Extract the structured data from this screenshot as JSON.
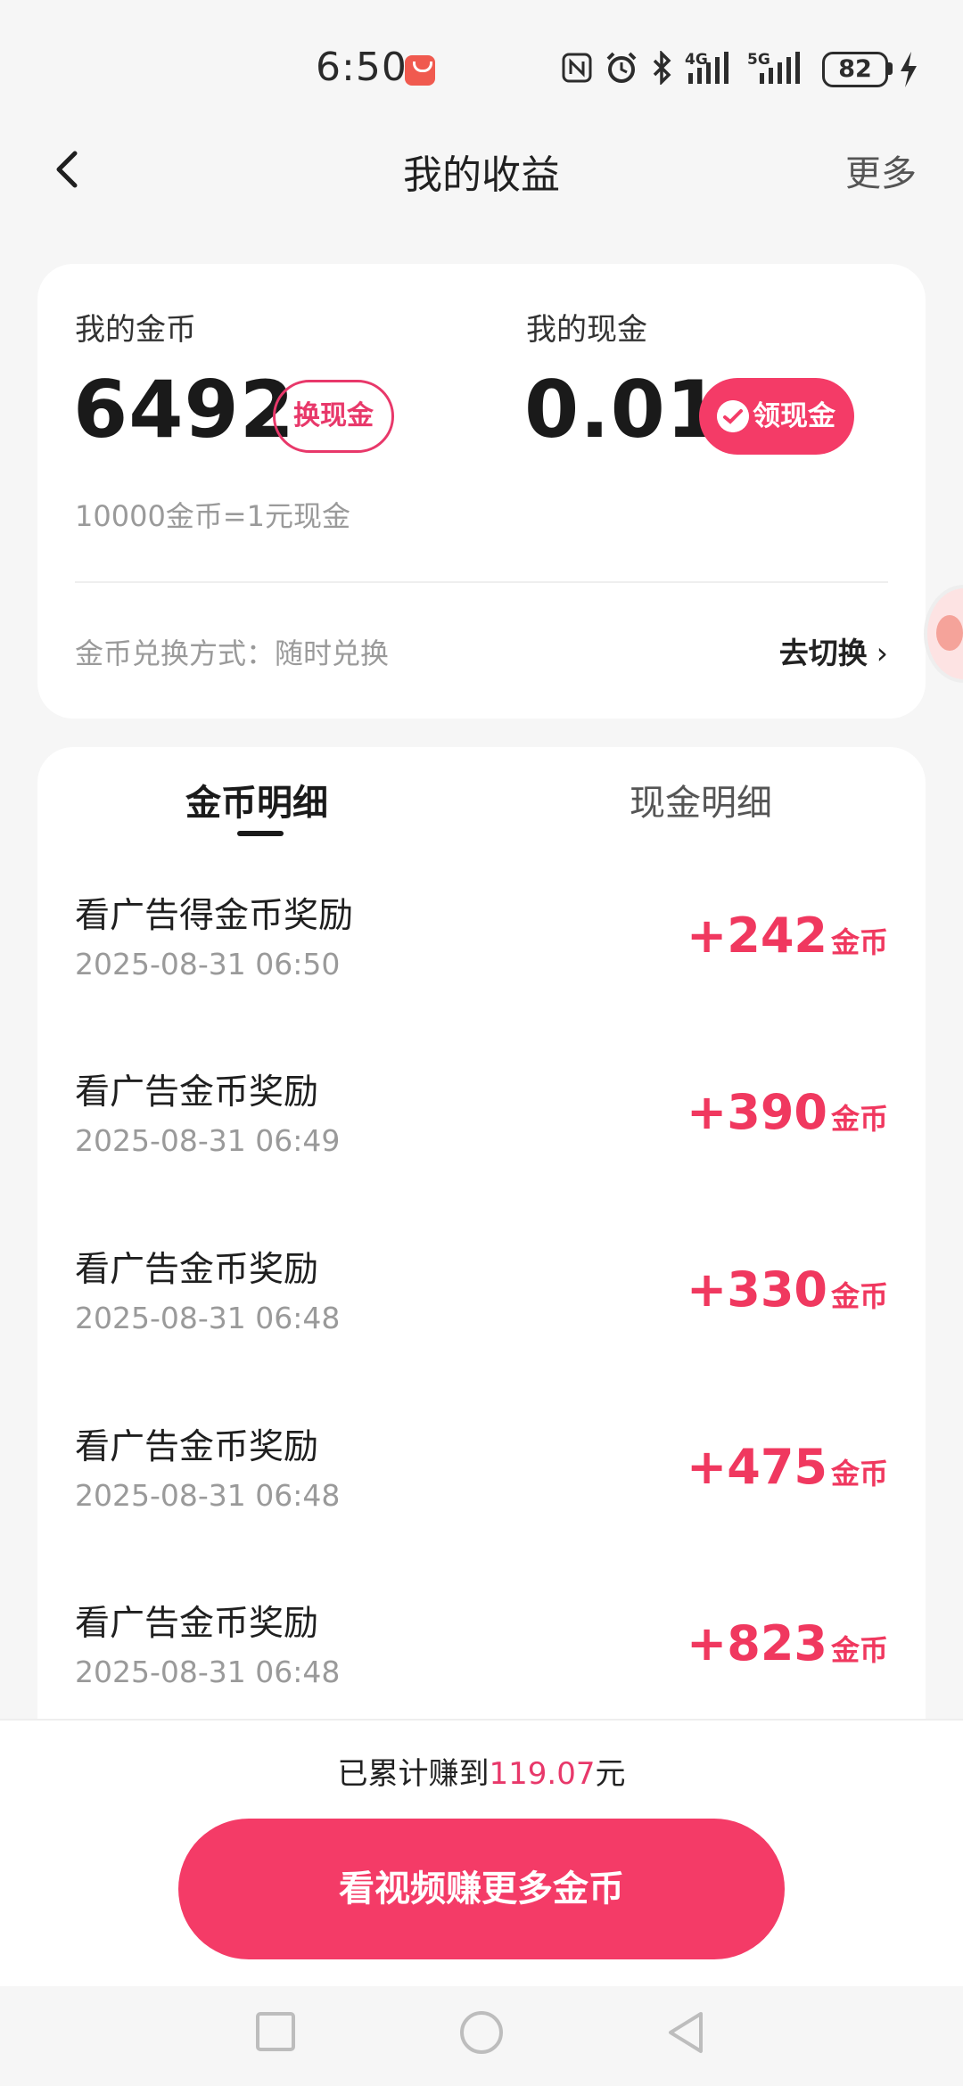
{
  "status_bar": {
    "time": "6:50",
    "network_4g": "4G",
    "network_5g": "5G",
    "battery": "82"
  },
  "header": {
    "title": "我的收益",
    "more_label": "更多"
  },
  "earnings": {
    "coins_label": "我的金币",
    "coins_value": "6492",
    "exchange_label": "换现金",
    "cash_label": "我的现金",
    "cash_value": "0.01",
    "claim_label": "领现金",
    "rate_text": "10000金币=1元现金",
    "mode_text": "金币兑换方式：随时兑换",
    "switch_label": "去切换"
  },
  "tabs": [
    {
      "label": "金币明细",
      "active": true
    },
    {
      "label": "现金明细",
      "active": false
    }
  ],
  "records": [
    {
      "title": "看广告得金币奖励",
      "date": "2025-08-31 06:50",
      "amount": "+242",
      "unit": "金币"
    },
    {
      "title": "看广告金币奖励",
      "date": "2025-08-31 06:49",
      "amount": "+390",
      "unit": "金币"
    },
    {
      "title": "看广告金币奖励",
      "date": "2025-08-31 06:48",
      "amount": "+330",
      "unit": "金币"
    },
    {
      "title": "看广告金币奖励",
      "date": "2025-08-31 06:48",
      "amount": "+475",
      "unit": "金币"
    },
    {
      "title": "看广告金币奖励",
      "date": "2025-08-31 06:48",
      "amount": "+823",
      "unit": "金币"
    }
  ],
  "footer": {
    "total_prefix": "已累计赚到",
    "total_value": "119.07",
    "total_suffix": "元",
    "cta_label": "看视频赚更多金币"
  },
  "colors": {
    "accent": "#f43b67",
    "amount": "#f0385f",
    "background": "#f6f6f6"
  },
  "icons": [
    "back-arrow-icon",
    "nfc-icon",
    "alarm-icon",
    "bluetooth-icon",
    "signal-icon",
    "battery-icon",
    "charging-bolt-icon",
    "wallet-icon",
    "chevron-right-icon",
    "recent-apps-icon",
    "home-icon",
    "back-triangle-icon"
  ]
}
